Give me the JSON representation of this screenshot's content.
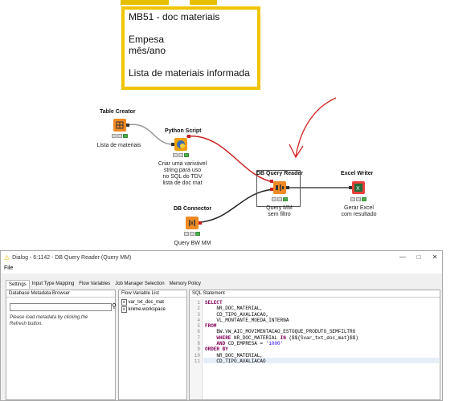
{
  "annotation": {
    "lines": [
      "MB51 - doc materiais",
      "",
      "Empesa",
      "mês/ano",
      "",
      "Lista de materiais informada"
    ]
  },
  "nodes": {
    "table_creator": {
      "title": "Table Creator",
      "desc": [
        "Lista de materiais"
      ]
    },
    "python_script": {
      "title": "Python Script",
      "desc": [
        "Criar uma varivável",
        "string para uso",
        "no SQL do TDV",
        "lista de doc mat"
      ]
    },
    "db_query_reader": {
      "title": "DB Query Reader",
      "desc": [
        "Query MM",
        "sem filtro"
      ]
    },
    "excel_writer": {
      "title": "Excel Writer",
      "desc": [
        "Gerar Excel",
        "com resultado"
      ]
    },
    "db_connector": {
      "title": "DB Connector",
      "desc": [
        "Query BW MM"
      ]
    }
  },
  "dialog": {
    "title": "Dialog - 6:1142 - DB Query Reader (Query MM)",
    "menu": "File",
    "tabs": [
      "Settings",
      "Input Type Mapping",
      "Flow Variables",
      "Job Manager Selection",
      "Memory Policy"
    ],
    "metadata_browser": {
      "header": "Database Metadata Browser",
      "message": [
        "Please load metadata by clicking the",
        "Refresh button."
      ]
    },
    "flow_variable_list": {
      "header": "Flow Variable List",
      "items": [
        "var_txt_doc_mat",
        "knime.workspace"
      ]
    },
    "sql_statement": {
      "header": "SQL Statement",
      "line_numbers": [
        "1",
        "2",
        "3",
        "4",
        "5",
        "6",
        "7",
        "8",
        "9",
        "10",
        "11"
      ],
      "lines": [
        "SELECT",
        "    NR_DOC_MATERIAL,",
        "    CD_TIPO_AVALIACAO,",
        "    VL_MONTANTE_MOEDA_INTERNA",
        "FROM",
        "    BW.VW_AIC_MOVIMENTACAO_ESTOQUE_PRODUTO_SEMFILTRO",
        "    WHERE NR_DOC_MATERIAL IN ($${Svar_txt_doc_mat}$$)",
        "    AND CD_EMPRESA = '1000'",
        "ORDER BY",
        "    NR_DOC_MATERIAL,",
        "    CD_TIPO_AVALIACAO"
      ]
    }
  },
  "colors": {
    "annotation_border": "#f0c400",
    "node_orange": "#f08a24",
    "node_red": "#e8403a",
    "red_arrow": "#d42020"
  }
}
